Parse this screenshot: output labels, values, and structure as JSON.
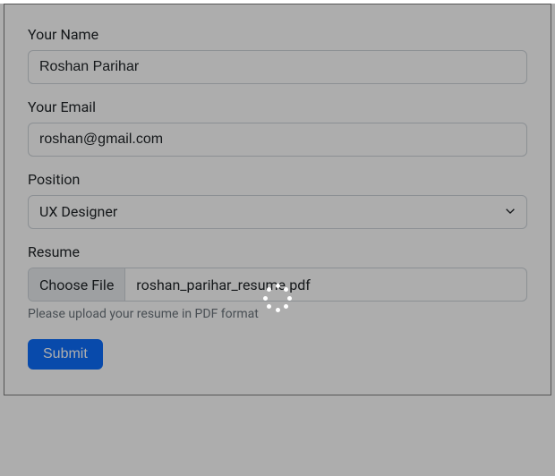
{
  "form": {
    "name": {
      "label": "Your Name",
      "value": "Roshan Parihar"
    },
    "email": {
      "label": "Your Email",
      "value": "roshan@gmail.com"
    },
    "position": {
      "label": "Position",
      "value": "UX Designer"
    },
    "resume": {
      "label": "Resume",
      "choose_label": "Choose File",
      "filename": "roshan_parihar_resume.pdf",
      "help_text": "Please upload your resume in PDF format"
    },
    "submit_label": "Submit"
  }
}
